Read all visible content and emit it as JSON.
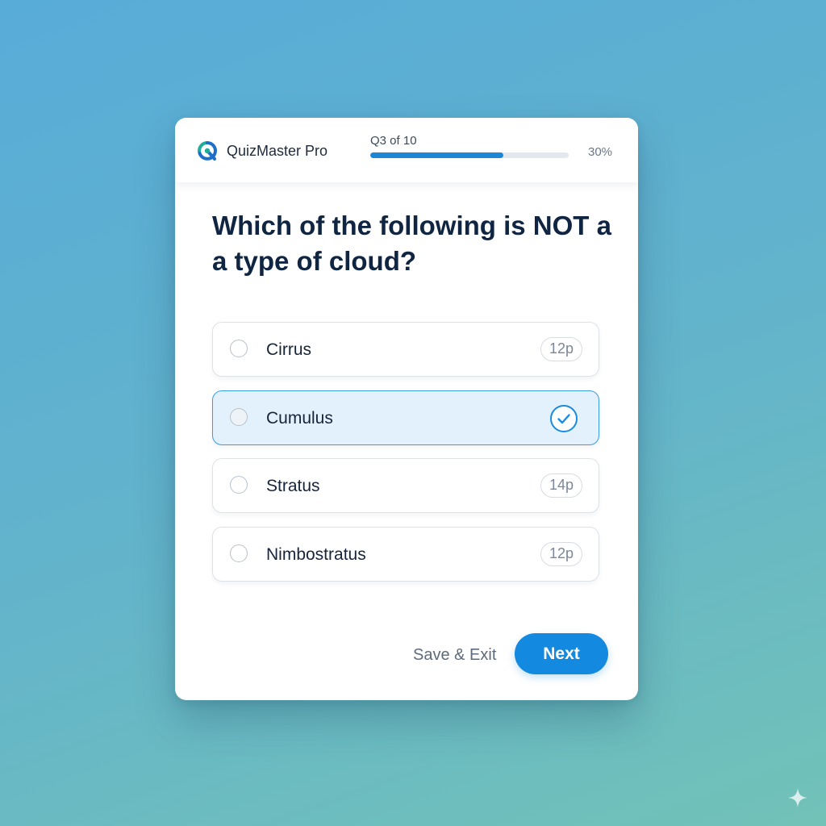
{
  "app": {
    "name": "QuizMaster Pro",
    "logo_icon": "quizmaster-q-logo-icon"
  },
  "progress": {
    "label": "Q3 of 10",
    "percent_text": "30%",
    "fraction": 0.67
  },
  "question": {
    "text": "Which of the following is NOT a a type of cloud?"
  },
  "options": [
    {
      "label": "Cirrus",
      "badge": "12p",
      "selected": false
    },
    {
      "label": "Cumulus",
      "badge": "",
      "selected": true,
      "selected_icon": "check-circle-icon"
    },
    {
      "label": "Stratus",
      "badge": "14p",
      "selected": false
    },
    {
      "label": "Nimbostratus",
      "badge": "12p",
      "selected": false
    }
  ],
  "actions": {
    "save_exit_label": "Save & Exit",
    "next_label": "Next"
  },
  "colors": {
    "accent": "#1389e0",
    "progress_fill": "#1f86d6",
    "selected_bg": "#e2f1fb",
    "selected_border": "#3a9de0",
    "question_text": "#0f2542",
    "logo_teal": "#1fae9a",
    "logo_blue": "#1f6fc9"
  }
}
